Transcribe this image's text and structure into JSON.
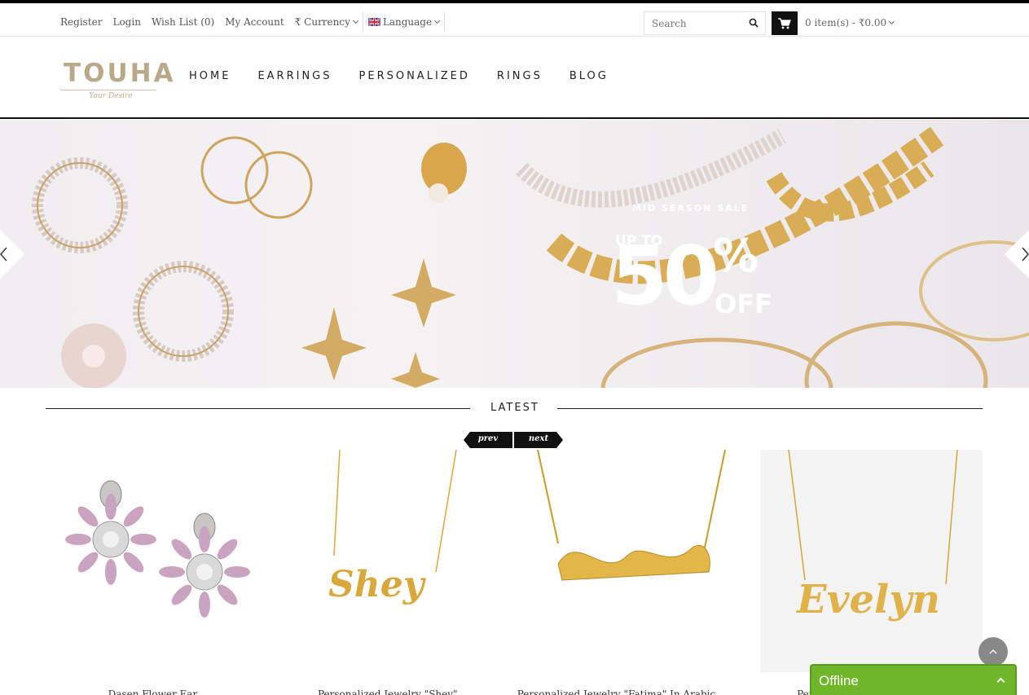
{
  "topbar": {
    "links": {
      "register": "Register",
      "login": "Login",
      "wishlist": "Wish List (0)",
      "account": "My Account"
    },
    "currency_label": "₹ Currency",
    "language_label": "Language",
    "search_placeholder": "Search",
    "cart_summary": "0 item(s) - ₹0.00"
  },
  "header": {
    "logo_text": "TOUHA",
    "logo_tagline": "Your Desire",
    "nav": [
      "HOME",
      "EARRINGS",
      "PERSONALIZED",
      "RINGS",
      "BLOG"
    ]
  },
  "banner": {
    "kicker": "MID SEASON SALE",
    "upto": "UP TO",
    "percent": "50",
    "percent_sign": "%",
    "off": "OFF"
  },
  "latest": {
    "title": "LATEST",
    "prev": "prev",
    "next": "next",
    "products": [
      {
        "title": "Dasen Flower Ear..."
      },
      {
        "title": "Personalized Jewelry \"Shey\"..."
      },
      {
        "title": "Personalized Jewelry \"Fatima\" In Arabic"
      },
      {
        "title": "Personalized Jewelry \"Evelyn\""
      }
    ]
  },
  "chat": {
    "status": "Offline"
  },
  "colors": {
    "accent_gold": "#b9a989",
    "chat_green": "#6fb62a",
    "dark": "#111111"
  }
}
